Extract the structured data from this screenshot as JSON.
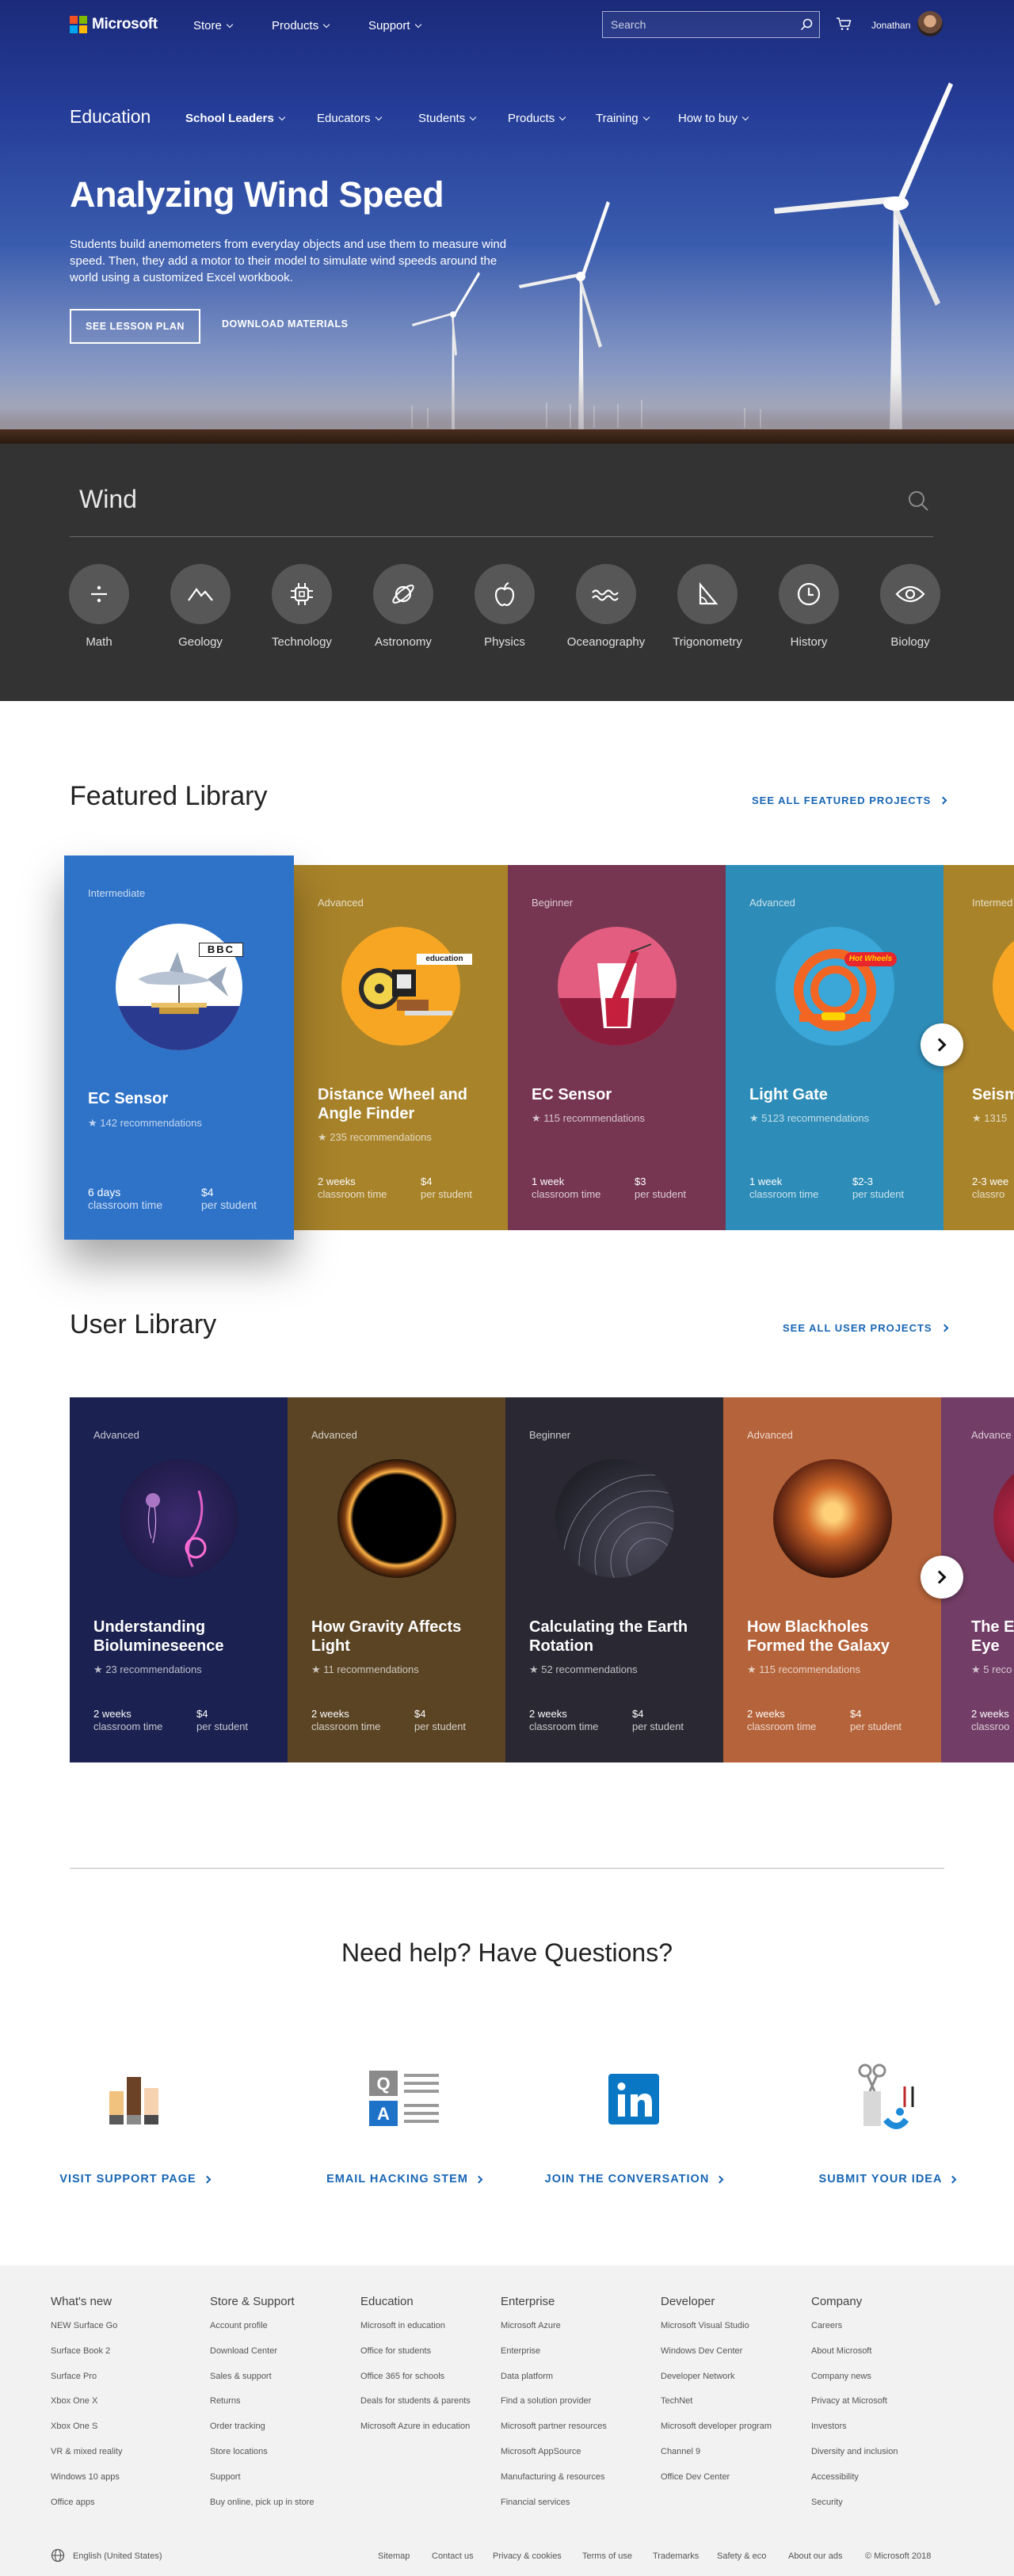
{
  "header": {
    "brand": "Microsoft",
    "top_menu": [
      "Store",
      "Products",
      "Support"
    ],
    "search_placeholder": "Search",
    "user_name": "Jonathan",
    "section": "Education",
    "sub_menu": [
      "School Leaders",
      "Educators",
      "Students",
      "Products",
      "Training",
      "How to buy"
    ]
  },
  "hero": {
    "title": "Analyzing Wind Speed",
    "description": "Students build anemometers from everyday objects and use them to measure wind speed. Then, they add a motor to their model to simulate wind speeds around the world using a customized Excel workbook.",
    "primary_button": "See lesson plan",
    "secondary_button": "Download materials"
  },
  "subjects": {
    "search_value": "Wind",
    "items": [
      {
        "label": "Math",
        "icon": "divide-icon"
      },
      {
        "label": "Geology",
        "icon": "mountain-icon"
      },
      {
        "label": "Technology",
        "icon": "chip-icon"
      },
      {
        "label": "Astronomy",
        "icon": "planet-icon"
      },
      {
        "label": "Physics",
        "icon": "apple-icon"
      },
      {
        "label": "Oceanography",
        "icon": "waves-icon"
      },
      {
        "label": "Trigonometry",
        "icon": "triangle-icon"
      },
      {
        "label": "History",
        "icon": "clock-icon"
      },
      {
        "label": "Biology",
        "icon": "eye-icon"
      }
    ]
  },
  "featured": {
    "title": "Featured Library",
    "see_all": "See all featured projects",
    "cards": [
      {
        "level": "Intermediate",
        "title": "EC Sensor",
        "recs": "142 recommendations",
        "time": "6 days",
        "time_label": "classroom time",
        "price": "$4",
        "price_label": "per student",
        "color": "#2f73c9",
        "badge": "BBC"
      },
      {
        "level": "Advanced",
        "title": "Distance Wheel and Angle Finder",
        "recs": "235 recommendations",
        "time": "2 weeks",
        "time_label": "classroom time",
        "price": "$4",
        "price_label": "per student",
        "color": "#a8832a",
        "badge": "education"
      },
      {
        "level": "Beginner",
        "title": "EC Sensor",
        "recs": "115 recommendations",
        "time": "1 week",
        "time_label": "classroom time",
        "price": "$3",
        "price_label": "per student",
        "color": "#763651"
      },
      {
        "level": "Advanced",
        "title": "Light Gate",
        "recs": "5123 recommendations",
        "time": "1 week",
        "time_label": "classroom time",
        "price": "$2-3",
        "price_label": "per student",
        "color": "#2e8db8",
        "badge": "Hot Wheels"
      },
      {
        "level": "Intermed",
        "title": "Seism",
        "recs": "1315",
        "time": "2-3 wee",
        "time_label": "classro",
        "price": "",
        "price_label": "",
        "color": "#a8832a"
      }
    ]
  },
  "user_library": {
    "title": "User Library",
    "see_all": "See all user projects",
    "cards": [
      {
        "level": "Advanced",
        "title": "Understanding Biolumineseence",
        "recs": "23 recommendations",
        "time": "2 weeks",
        "time_label": "classroom time",
        "price": "$4",
        "price_label": "per student",
        "color": "#1b2150"
      },
      {
        "level": "Advanced",
        "title": "How Gravity Affects Light",
        "recs": "11 recommendations",
        "time": "2 weeks",
        "time_label": "classroom time",
        "price": "$4",
        "price_label": "per student",
        "color": "#5a4424"
      },
      {
        "level": "Beginner",
        "title": "Calculating the Earth Rotation",
        "recs": "52 recommendations",
        "time": "2 weeks",
        "time_label": "classroom time",
        "price": "$4",
        "price_label": "per student",
        "color": "#2a2833"
      },
      {
        "level": "Advanced",
        "title": "How Blackholes Formed the Galaxy",
        "recs": "115 recommendations",
        "time": "2 weeks",
        "time_label": "classroom time",
        "price": "$4",
        "price_label": "per student",
        "color": "#b5633a"
      },
      {
        "level": "Advance",
        "title": "The E Eye",
        "recs": "5 reco",
        "time": "2 weeks",
        "time_label": "classroo",
        "price": "",
        "price_label": "",
        "color": "#723d66"
      }
    ]
  },
  "help": {
    "title": "Need help? Have Questions?",
    "links": [
      "Visit support page",
      "Email Hacking STEM",
      "Join the conversation",
      "Submit your idea"
    ]
  },
  "footer": {
    "columns": [
      {
        "heading": "What's new",
        "links": [
          "NEW Surface Go",
          "Surface Book 2",
          "Surface Pro",
          "Xbox One X",
          "Xbox One S",
          "VR & mixed reality",
          "Windows 10 apps",
          "Office apps"
        ]
      },
      {
        "heading": "Store & Support",
        "links": [
          "Account profile",
          "Download Center",
          "Sales & support",
          "Returns",
          "Order tracking",
          "Store locations",
          "Support",
          "Buy online, pick up in store"
        ]
      },
      {
        "heading": "Education",
        "links": [
          "Microsoft in education",
          "Office for students",
          "Office 365 for schools",
          "Deals for students & parents",
          "Microsoft Azure in education"
        ]
      },
      {
        "heading": "Enterprise",
        "links": [
          "Microsoft Azure",
          "Enterprise",
          "Data platform",
          "Find a solution provider",
          "Microsoft partner resources",
          "Microsoft AppSource",
          "Manufacturing & resources",
          "Financial services"
        ]
      },
      {
        "heading": "Developer",
        "links": [
          "Microsoft Visual Studio",
          "Windows Dev Center",
          "Developer Network",
          "TechNet",
          "Microsoft developer program",
          "Channel 9",
          "Office Dev Center"
        ]
      },
      {
        "heading": "Company",
        "links": [
          "Careers",
          "About Microsoft",
          "Company news",
          "Privacy at Microsoft",
          "Investors",
          "Diversity and inclusion",
          "Accessibility",
          "Security"
        ]
      }
    ],
    "locale": "English (United States)",
    "bottom_links": [
      "Sitemap",
      "Contact us",
      "Privacy & cookies",
      "Terms of use",
      "Trademarks",
      "Safety & eco",
      "About our ads"
    ],
    "copyright": "© Microsoft 2018"
  }
}
